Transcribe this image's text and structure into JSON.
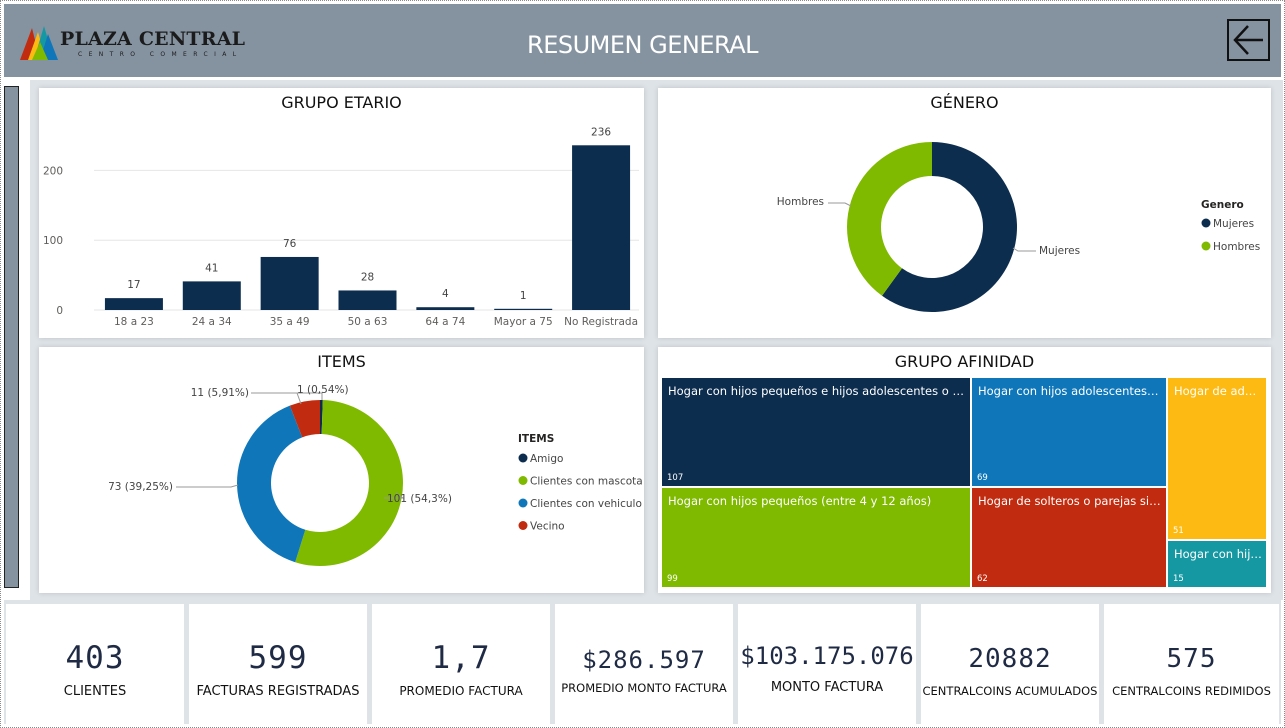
{
  "header": {
    "logo_main": "PLAZA CENTRAL",
    "logo_sub": "CENTRO COMERCIAL",
    "title": "RESUMEN GENERAL",
    "back_icon": "arrow-left-icon"
  },
  "colors": {
    "navy": "#0d2d4f",
    "green": "#7fba00",
    "blue": "#0f77b9",
    "red": "#c12b0f",
    "yellow": "#fdba13",
    "teal": "#1698a3",
    "header": "#8593a1"
  },
  "grupo_etario": {
    "title": "GRUPO ETARIO",
    "chart_data": {
      "type": "bar",
      "categories": [
        "18 a 23",
        "24 a 34",
        "35 a 49",
        "50 a 63",
        "64 a 74",
        "Mayor a 75",
        "No Registrada"
      ],
      "values": [
        17,
        41,
        76,
        28,
        4,
        1,
        236
      ],
      "data_labels": [
        "17",
        "41",
        "76",
        "28",
        "4",
        "1",
        "236"
      ],
      "yticks": [
        "0",
        "100",
        "200"
      ],
      "ylim": [
        0,
        245
      ],
      "grid": true
    }
  },
  "genero": {
    "title": "GÉNERO",
    "legend_title": "Genero",
    "chart_data": {
      "type": "pie",
      "donut": true,
      "categories": [
        "Mujeres",
        "Hombres"
      ],
      "values": [
        60,
        40
      ],
      "colors": [
        "#0d2d4f",
        "#7fba00"
      ],
      "legend_position": "right"
    }
  },
  "items": {
    "title": "ITEMS",
    "legend_title": "ITEMS",
    "chart_data": {
      "type": "pie",
      "donut": true,
      "categories": [
        "Amigo",
        "Clientes con mascota",
        "Clientes con vehiculo",
        "Vecino"
      ],
      "values": [
        1,
        101,
        73,
        11
      ],
      "data_labels": [
        "1 (0,54%)",
        "101 (54,3%)",
        "73 (39,25%)",
        "11 (5,91%)"
      ],
      "colors": [
        "#0d2d4f",
        "#7fba00",
        "#0f77b9",
        "#c12b0f"
      ],
      "legend_position": "right"
    }
  },
  "grupo_afinidad": {
    "title": "GRUPO AFINIDAD",
    "cells": [
      {
        "label": "Hogar con hijos pequeños e hijos adolescentes o mayores",
        "value": "107"
      },
      {
        "label": "Hogar con hijos adolescentes o mayores",
        "value": "69"
      },
      {
        "label": "Hogar de adultos mayores",
        "value": "51"
      },
      {
        "label": "Hogar con hijos pequeños (entre 4 y 12 años)",
        "value": "99"
      },
      {
        "label": "Hogar de solteros o parejas sin hijos",
        "value": "62"
      },
      {
        "label": "Hogar con hijos bebés",
        "value": "15"
      }
    ]
  },
  "kpis": [
    {
      "value": "403",
      "label": "CLIENTES"
    },
    {
      "value": "599",
      "label": "FACTURAS REGISTRADAS"
    },
    {
      "value": "1,7",
      "label": "PROMEDIO FACTURA"
    },
    {
      "value": "$286.597",
      "label": "PROMEDIO MONTO FACTURA"
    },
    {
      "value": "$103.175.076",
      "label": "MONTO FACTURA"
    },
    {
      "value": "20882",
      "label": "CENTRALCOINS ACUMULADOS"
    },
    {
      "value": "575",
      "label": "CENTRALCOINS REDIMIDOS"
    }
  ]
}
